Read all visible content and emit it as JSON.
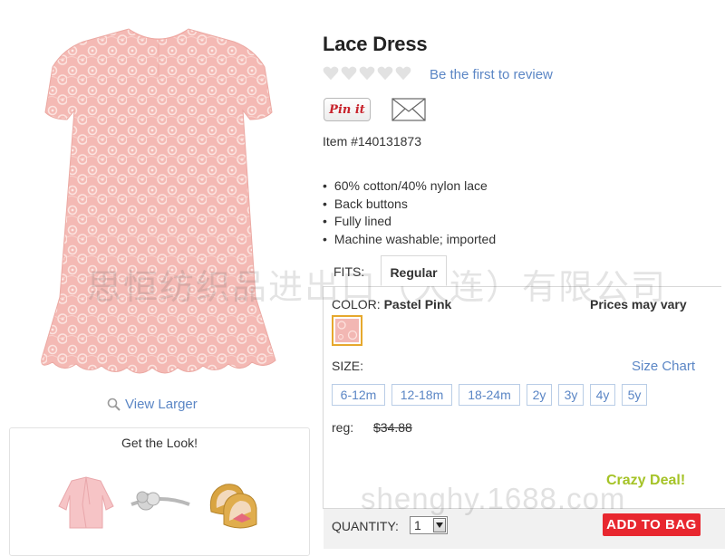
{
  "product": {
    "title": "Lace Dress",
    "rating": {
      "hearts": 5,
      "filled": 0
    },
    "review_link": "Be the first to review",
    "pin_label": "Pin it",
    "item_number": "Item #140131873",
    "features": [
      "60% cotton/40% nylon lace",
      "Back buttons",
      "Fully lined",
      "Machine washable; imported"
    ],
    "view_larger": "View Larger"
  },
  "get_the_look": {
    "title": "Get the Look!",
    "items": [
      "pink-cardigan",
      "silver-headband",
      "gold-flats"
    ]
  },
  "options": {
    "fits_label": "FITS:",
    "fit_selected": "Regular",
    "color_label": "COLOR:",
    "color_value": "Pastel Pink",
    "prices_note": "Prices may vary",
    "size_label": "SIZE:",
    "size_chart": "Size Chart",
    "sizes": [
      "6-12m",
      "12-18m",
      "18-24m",
      "2y",
      "3y",
      "4y",
      "5y"
    ],
    "reg_label": "reg:",
    "reg_price": "$34.88",
    "deal": "Crazy Deal!",
    "quantity_label": "QUANTITY:",
    "quantity_value": "1",
    "add_to_bag": "ADD TO BAG"
  },
  "watermarks": {
    "company": "思恒纺织品进出口（大连）有限公司",
    "site": "shenghy.1688.com"
  },
  "colors": {
    "link": "#5b86c5",
    "deal": "#a5c327",
    "add_to_bag": "#e8272f",
    "swatch_border": "#e6a82d",
    "dress": "#f4b9b4"
  }
}
